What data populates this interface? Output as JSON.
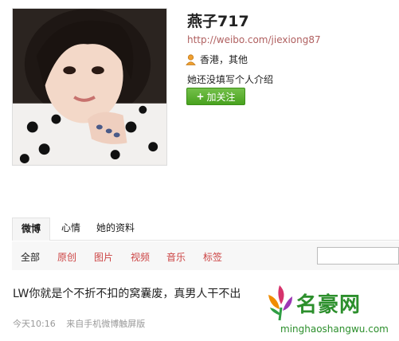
{
  "profile": {
    "nickname": "燕子717",
    "url": "http://weibo.com/jiexiong87",
    "location": "香港，其他",
    "bio": "她还没填写个人介绍",
    "follow_label": "加关注"
  },
  "tabs": [
    {
      "label": "微博",
      "active": true
    },
    {
      "label": "心情",
      "active": false
    },
    {
      "label": "她的资料",
      "active": false
    }
  ],
  "filters": [
    "全部",
    "原创",
    "图片",
    "视频",
    "音乐",
    "标签"
  ],
  "post": {
    "text": "LW你就是个不折不扣的窝囊废，真男人干不出",
    "time": "今天10:16",
    "source": "来自手机微博触屏版"
  },
  "watermark": {
    "title": "名豪网",
    "url": "minghaoshangwu.com"
  },
  "colors": {
    "follow_green": "#48a21e",
    "link_red": "#c44444",
    "watermark_green": "#2c8f2c"
  }
}
